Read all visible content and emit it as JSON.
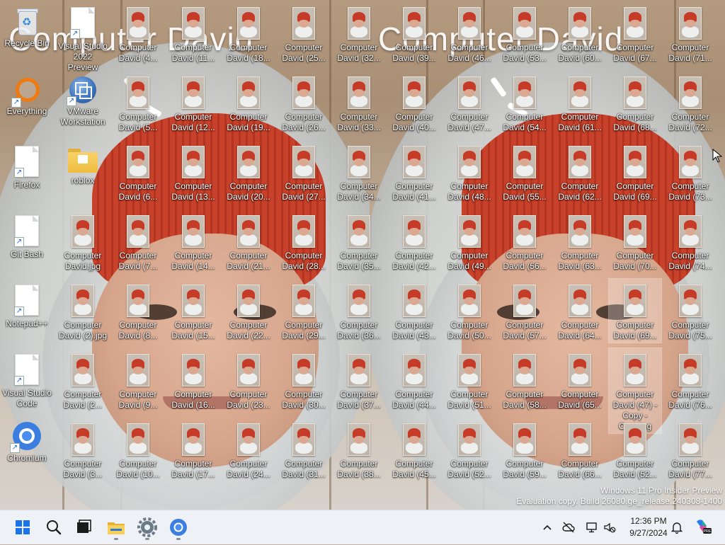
{
  "wallpaper": {
    "title_text": "Computer David"
  },
  "desktop": {
    "left_column": [
      {
        "label": "Recycle Bin",
        "kind": "recycle-bin"
      },
      {
        "label": "Everything",
        "kind": "everything-app"
      },
      {
        "label": "Firefox",
        "kind": "file-shortcut"
      },
      {
        "label": "Git Bash",
        "kind": "file-shortcut"
      },
      {
        "label": "Notepad++",
        "kind": "file-shortcut"
      },
      {
        "label": "Visual Studio Code",
        "kind": "file-shortcut"
      },
      {
        "label": "Chromium",
        "kind": "chromium"
      }
    ],
    "second_column": [
      {
        "label": "Visual Studio 2022 Preview",
        "kind": "file-shortcut"
      },
      {
        "label": "VMware Workstation",
        "kind": "vmware"
      },
      {
        "label": "roblox",
        "kind": "folder"
      },
      {
        "label": "Computer David.jpg",
        "kind": "image"
      },
      {
        "label": "Computer David (2).jpg",
        "kind": "image"
      },
      {
        "label": "Computer David (2...",
        "kind": "image"
      },
      {
        "label": "Computer David (3...",
        "kind": "image"
      }
    ],
    "image_columns": [
      [
        "Computer David (4...",
        "Computer David (5...",
        "Computer David (6...",
        "Computer David (7...",
        "Computer David (8...",
        "Computer David (9...",
        "Computer David (10..."
      ],
      [
        "Computer David (11...",
        "Computer David (12...",
        "Computer David (13...",
        "Computer David (14...",
        "Computer David (15...",
        "Computer David (16...",
        "Computer David (17..."
      ],
      [
        "Computer David (18...",
        "Computer David (19...",
        "Computer David (20...",
        "Computer David (21...",
        "Computer David (22...",
        "Computer David (23...",
        "Computer David (24..."
      ],
      [
        "Computer David (25...",
        "Computer David (26...",
        "Computer David (27...",
        "Computer David (28...",
        "Computer David (29...",
        "Computer David (30...",
        "Computer David (31..."
      ],
      [
        "Computer David (32...",
        "Computer David (33...",
        "Computer David (34...",
        "Computer David (35...",
        "Computer David (36...",
        "Computer David (37...",
        "Computer David (38..."
      ],
      [
        "Computer David (39...",
        "Computer David (40...",
        "Computer David (41...",
        "Computer David (42...",
        "Computer David (43...",
        "Computer David (44...",
        "Computer David (45..."
      ],
      [
        "Computer David (46...",
        "Computer David (47...",
        "Computer David (48...",
        "Computer David (49...",
        "Computer David (50...",
        "Computer David (51...",
        "Computer David (52..."
      ],
      [
        "Computer David (53...",
        "Computer David (54...",
        "Computer David (55...",
        "Computer David (56...",
        "Computer David (57...",
        "Computer David (58...",
        "Computer David (59..."
      ],
      [
        "Computer David (60...",
        "Computer David (61...",
        "Computer David (62...",
        "Computer David (63...",
        "Computer David (64...",
        "Computer David (65...",
        "Computer David (66..."
      ],
      [
        "Computer David (67...",
        "Computer David (68...",
        "Computer David (69...",
        "Computer David (70...",
        "Computer David (69...",
        "Computer David (47) - Copy - Copy.jpg",
        "Computer David (52..."
      ],
      [
        "Computer David (71...",
        "Computer David (72...",
        "Computer David (73...",
        "Computer David (74...",
        "Computer David (75...",
        "Computer David (76...",
        "Computer David (77..."
      ]
    ],
    "selected_items": [
      "Computer David (69...",
      "Computer David (47) - Copy - Copy.jpg"
    ]
  },
  "watermark": {
    "line1": "Windows 11 Pro Insider Preview",
    "line2": "Evaluation copy. Build 26080.ge_release.240308-1400"
  },
  "taskbar": {
    "pinned": [
      {
        "name": "start",
        "icon": "windows-logo-icon"
      },
      {
        "name": "search",
        "icon": "search-icon"
      },
      {
        "name": "task-view",
        "icon": "task-view-icon"
      },
      {
        "name": "file-explorer",
        "icon": "folder-icon"
      },
      {
        "name": "settings",
        "icon": "gear-icon"
      },
      {
        "name": "chromium",
        "icon": "chromium-icon"
      }
    ],
    "tray": {
      "time": "12:36 PM",
      "date": "9/27/2024",
      "icons": [
        "chevron-up-icon",
        "cloud-off-icon",
        "network-icon",
        "volume-icon",
        "bell-icon",
        "copilot-icon"
      ]
    },
    "accent": "#1a73e8"
  }
}
